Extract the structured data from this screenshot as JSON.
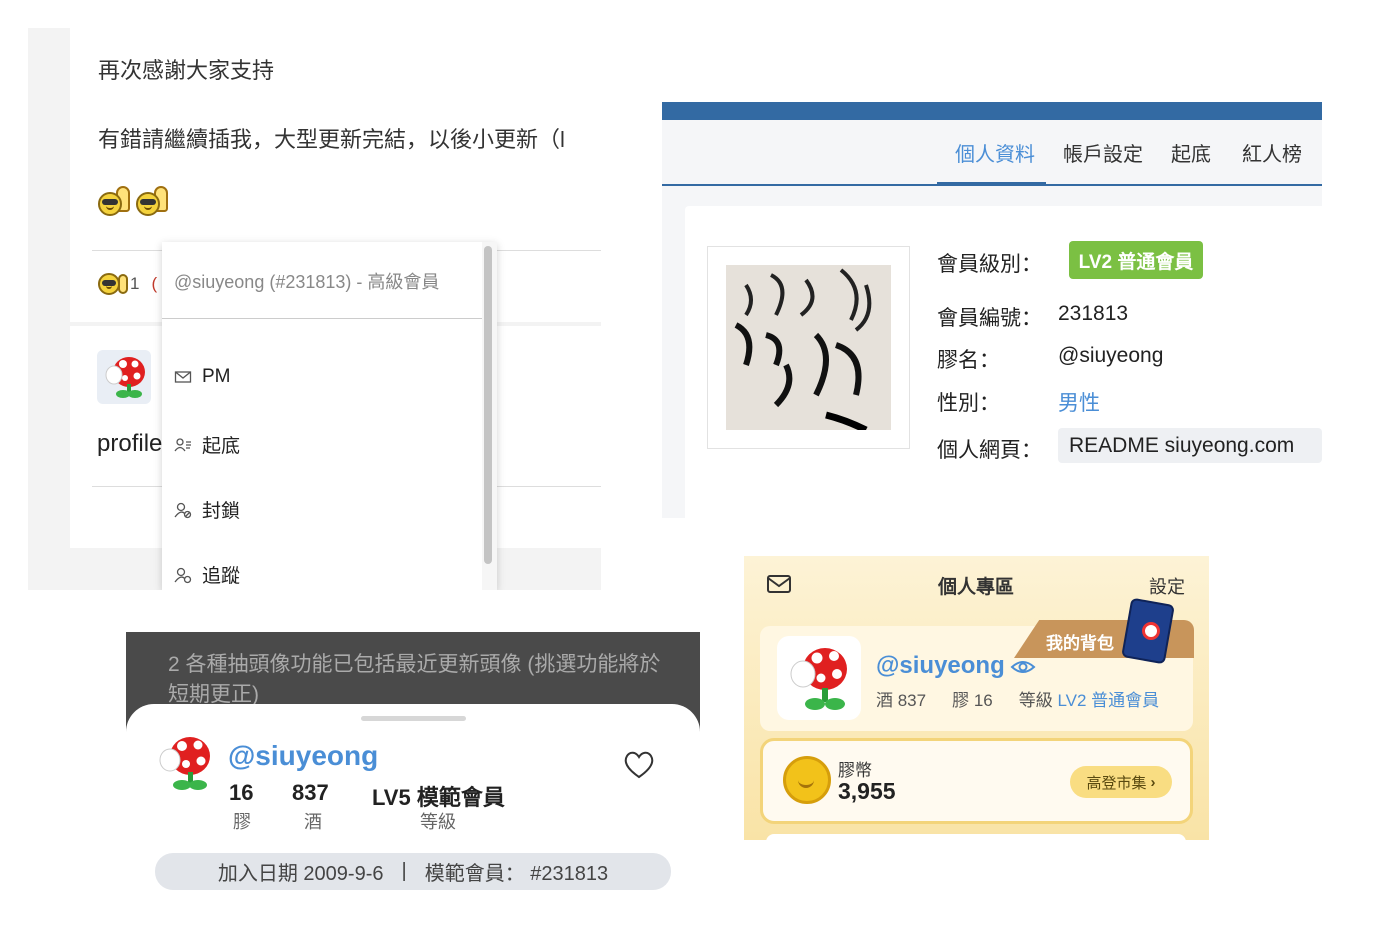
{
  "forum": {
    "line1": "再次感謝大家支持",
    "line2": "有錯請繼續插我，大型更新完結，以後小更新（l",
    "reaction_count": "1",
    "profile_label": "profile",
    "menu": {
      "header": "@siuyeong (#231813) - 高級會員",
      "items": [
        {
          "label": "PM",
          "icon": "mail-icon"
        },
        {
          "label": "起底",
          "icon": "user-list-icon"
        },
        {
          "label": "封鎖",
          "icon": "user-block-icon"
        },
        {
          "label": "追蹤",
          "icon": "user-follow-icon"
        }
      ]
    }
  },
  "profile_page": {
    "tabs": [
      "個人資料",
      "帳戶設定",
      "起底",
      "紅人榜"
    ],
    "active_tab": "個人資料",
    "fields": {
      "level_label": "會員級別：",
      "level_value": "LV2 普通會員",
      "id_label": "會員編號：",
      "id_value": "231813",
      "name_label": "膠名：",
      "name_value": "@siuyeong",
      "gender_label": "性別：",
      "gender_value": "男性",
      "web_label": "個人網頁：",
      "web_value": "README siuyeong.com"
    },
    "colors": {
      "accent": "#336aa3",
      "link": "#4a8ed6",
      "badge": "#7bc043"
    }
  },
  "mobile_sheet": {
    "background_text": "2 各種抽頭像功能已包括最近更新頭像 (挑選功能將於短期更正)",
    "username": "@siuyeong",
    "stats": [
      {
        "value": "16",
        "label": "膠"
      },
      {
        "value": "837",
        "label": "酒"
      },
      {
        "value": "LV5 模範會員",
        "label": "等級"
      }
    ],
    "join_text": "加入日期 2009-9-6",
    "divider": "|",
    "member_text": "模範會員： #231813"
  },
  "zone": {
    "title": "個人專區",
    "settings": "設定",
    "bag": "我的背包",
    "username": "@siuyeong",
    "stat_wine": "酒 837",
    "stat_glue": "膠 16",
    "stat_level_prefix": "等級",
    "stat_level": "LV2 普通會員",
    "coin_label": "膠幣",
    "coin_value": "3,955",
    "market": "高登市集"
  }
}
